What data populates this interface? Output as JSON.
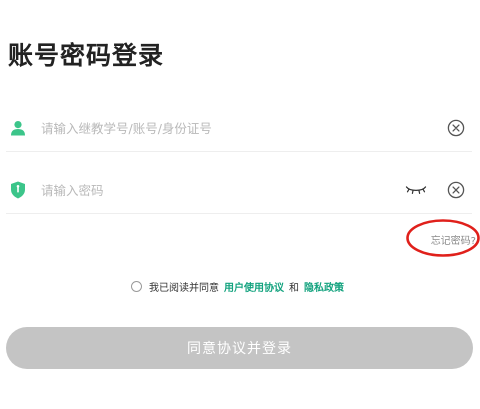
{
  "page": {
    "title": "账号密码登录"
  },
  "account_field": {
    "placeholder": "请输入继教学号/账号/身份证号",
    "value": ""
  },
  "password_field": {
    "placeholder": "请输入密码",
    "value": ""
  },
  "forgot_password": {
    "label": "忘记密码?"
  },
  "agreement": {
    "prefix": "我已阅读并同意",
    "user_agreement": "用户使用协议",
    "connector": "和",
    "privacy_policy": "隐私政策",
    "checked": false
  },
  "login_button": {
    "label": "同意协议并登录"
  },
  "icons": {
    "account": "user-icon",
    "password": "shield-icon",
    "clear": "circle-x-icon",
    "visibility": "eye-closed-icon"
  },
  "colors": {
    "accent": "#3cc58a",
    "link": "#14a37f",
    "button_disabled": "#c4c4c4",
    "annotation": "#e0201b"
  }
}
